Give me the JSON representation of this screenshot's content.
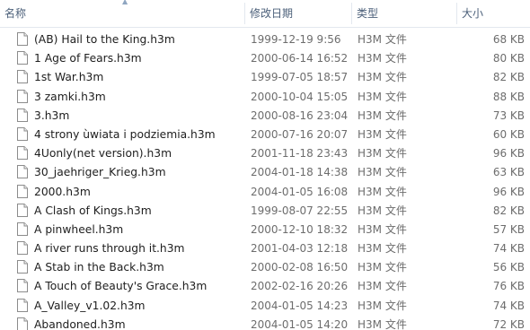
{
  "columns": {
    "name": "名称",
    "date": "修改日期",
    "type": "类型",
    "size": "大小"
  },
  "files": [
    {
      "name": "(AB) Hail to the King.h3m",
      "date": "1999-12-19 9:56",
      "type": "H3M 文件",
      "size": "68 KB"
    },
    {
      "name": "1 Age of Fears.h3m",
      "date": "2000-06-14 16:52",
      "type": "H3M 文件",
      "size": "80 KB"
    },
    {
      "name": "1st War.h3m",
      "date": "1999-07-05 18:57",
      "type": "H3M 文件",
      "size": "82 KB"
    },
    {
      "name": "3 zamki.h3m",
      "date": "2000-10-04 15:05",
      "type": "H3M 文件",
      "size": "88 KB"
    },
    {
      "name": "3.h3m",
      "date": "2000-08-16 23:04",
      "type": "H3M 文件",
      "size": "73 KB"
    },
    {
      "name": "4 strony ùwiata i podziemia.h3m",
      "date": "2000-07-16 20:07",
      "type": "H3M 文件",
      "size": "60 KB"
    },
    {
      "name": "4Uonly(net version).h3m",
      "date": "2001-11-18 23:43",
      "type": "H3M 文件",
      "size": "96 KB"
    },
    {
      "name": "30_jaehriger_Krieg.h3m",
      "date": "2004-01-18 14:38",
      "type": "H3M 文件",
      "size": "63 KB"
    },
    {
      "name": "2000.h3m",
      "date": "2004-01-05 16:08",
      "type": "H3M 文件",
      "size": "96 KB"
    },
    {
      "name": "A Clash of Kings.h3m",
      "date": "1999-08-07 22:55",
      "type": "H3M 文件",
      "size": "82 KB"
    },
    {
      "name": "A pinwheel.h3m",
      "date": "2000-12-10 18:32",
      "type": "H3M 文件",
      "size": "57 KB"
    },
    {
      "name": "A river runs through it.h3m",
      "date": "2001-04-03 12:18",
      "type": "H3M 文件",
      "size": "74 KB"
    },
    {
      "name": "A Stab in the Back.h3m",
      "date": "2000-02-08 16:50",
      "type": "H3M 文件",
      "size": "56 KB"
    },
    {
      "name": "A Touch of Beauty's Grace.h3m",
      "date": "2002-02-16 20:26",
      "type": "H3M 文件",
      "size": "76 KB"
    },
    {
      "name": "A_Valley_v1.02.h3m",
      "date": "2004-01-05 14:23",
      "type": "H3M 文件",
      "size": "74 KB"
    },
    {
      "name": "Abandoned.h3m",
      "date": "2004-01-05 14:20",
      "type": "H3M 文件",
      "size": "72 KB"
    }
  ],
  "icons": {
    "file": "file-icon",
    "sort": "sort-up-icon"
  },
  "colors": {
    "header_text": "#4c607a",
    "divider": "#e3e8ef",
    "name_text": "#1e1e1e",
    "meta_text": "#6d6d6d"
  }
}
